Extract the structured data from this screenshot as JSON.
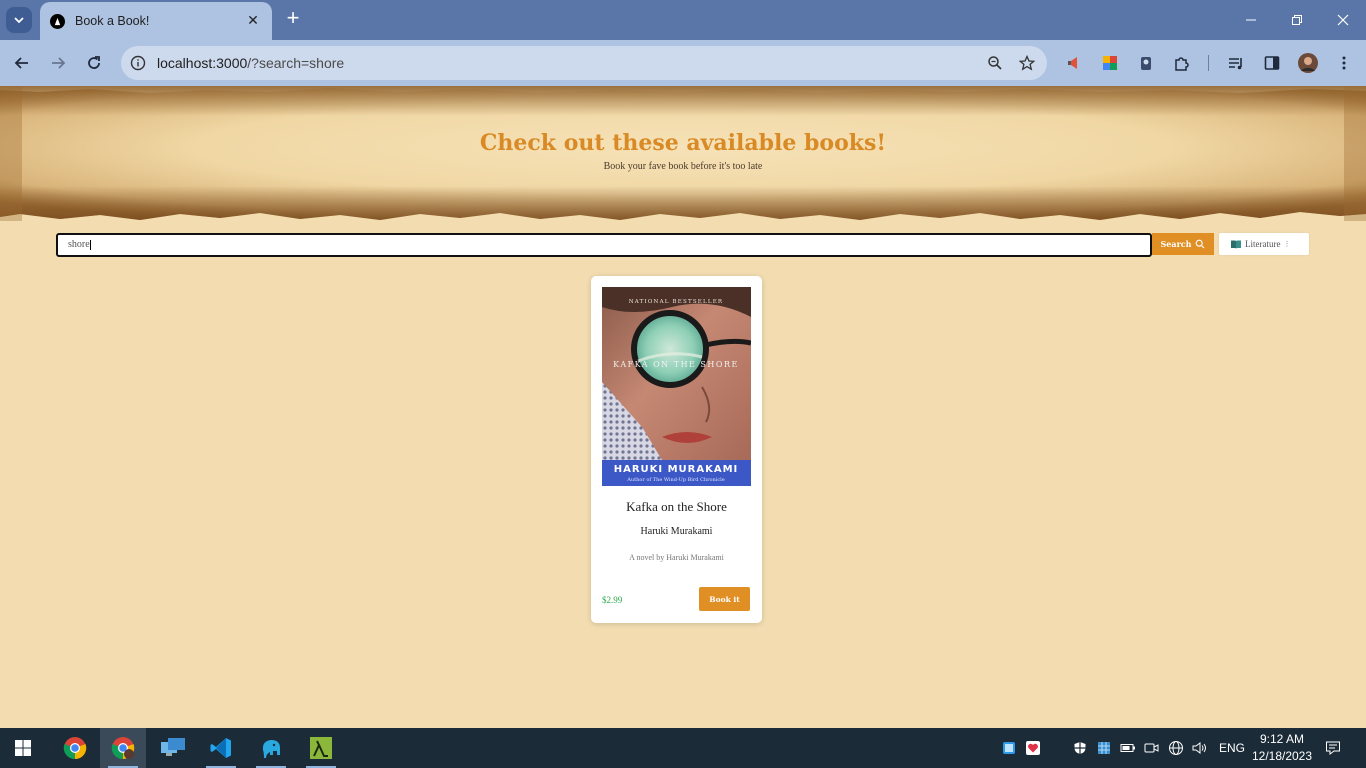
{
  "browser": {
    "tab_title": "Book a Book!",
    "url_host": "localhost:3000",
    "url_path": "/?search=shore"
  },
  "hero": {
    "title": "Check out these available books!",
    "subtitle": "Book your fave book before it's too late"
  },
  "search": {
    "value": "shore",
    "button_label": "Search",
    "category_label": "Literature"
  },
  "books": [
    {
      "title": "Kafka on the Shore",
      "author": "Haruki Murakami",
      "description": "A novel by Haruki Murakami",
      "price": "$2.99",
      "button_label": "Book it",
      "cover": {
        "banner_top": "NATIONAL BESTSELLER",
        "cover_title": "KAFKA ON THE SHORE",
        "cover_author": "HARUKI MURAKAMI",
        "cover_tagline": "Author of The Wind-Up Bird Chronicle"
      }
    }
  ],
  "taskbar": {
    "time": "9:12 AM",
    "date": "12/18/2023",
    "language": "ENG"
  },
  "colors": {
    "accent": "#e08f25",
    "title": "#d98a25",
    "price": "#2fa84f",
    "page_bg": "#f2dcb0"
  }
}
